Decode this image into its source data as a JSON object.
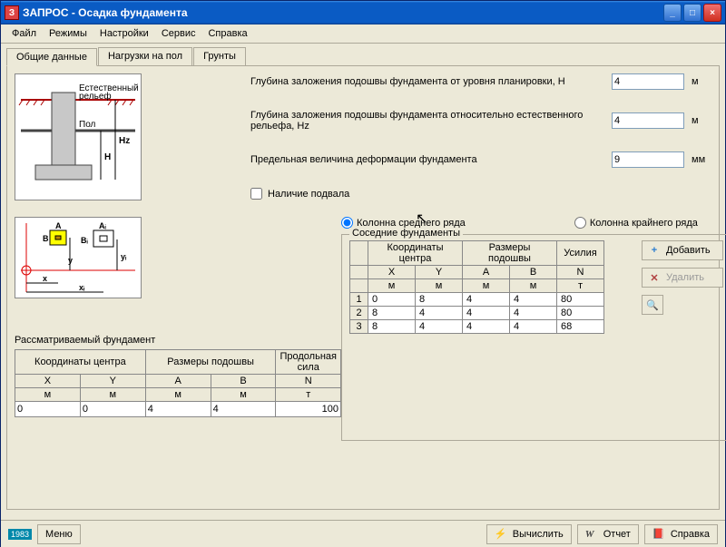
{
  "title": "ЗАПРОС - Осадка фундамента",
  "menu": [
    "Файл",
    "Режимы",
    "Настройки",
    "Сервис",
    "Справка"
  ],
  "tabs": [
    "Общие данные",
    "Нагрузки на пол",
    "Грунты"
  ],
  "diagram1_labels": {
    "top": "Естественный\nрельеф",
    "pol": "Пол",
    "hz": "Hz",
    "h": "H"
  },
  "fields": {
    "depth_h": {
      "label": "Глубина заложения подошвы фундамента от уровня планировки, H",
      "value": "4",
      "unit": "м"
    },
    "depth_hz": {
      "label": "Глубина заложения подошвы фундамента относительно естественного рельефа, Hz",
      "value": "4",
      "unit": "м"
    },
    "limit_def": {
      "label": "Предельная величина деформации фундамента",
      "value": "9",
      "unit": "мм"
    },
    "basement": {
      "label": "Наличие подвала"
    }
  },
  "radios": {
    "middle": "Колонна среднего ряда",
    "edge": "Колонна крайнего ряда"
  },
  "neighbor": {
    "legend": "Соседние фундаменты",
    "group_headers": [
      "Координаты центра",
      "Размеры подошвы",
      "Усилия"
    ],
    "col_headers": [
      "X",
      "Y",
      "A",
      "B",
      "N"
    ],
    "unit_headers": [
      "м",
      "м",
      "м",
      "м",
      "т"
    ],
    "rows": [
      {
        "n": "1",
        "x": "0",
        "y": "8",
        "a": "4",
        "b": "4",
        "N": "80"
      },
      {
        "n": "2",
        "x": "8",
        "y": "4",
        "a": "4",
        "b": "4",
        "N": "80"
      },
      {
        "n": "3",
        "x": "8",
        "y": "4",
        "a": "4",
        "b": "4",
        "N": "68"
      }
    ],
    "add": "Добавить",
    "del": "Удалить"
  },
  "main_fund": {
    "title": "Рассматриваемый фундамент",
    "group_headers": [
      "Координаты центра",
      "Размеры подошвы",
      "Продольная сила"
    ],
    "col_headers": [
      "X",
      "Y",
      "A",
      "B",
      "N"
    ],
    "unit_headers": [
      "м",
      "м",
      "м",
      "м",
      "т"
    ],
    "values": {
      "x": "0",
      "y": "0",
      "a": "4",
      "b": "4",
      "N": "100"
    }
  },
  "footer": {
    "menu": "Меню",
    "calc": "Вычислить",
    "report": "Отчет",
    "help": "Справка",
    "year": "1983"
  }
}
